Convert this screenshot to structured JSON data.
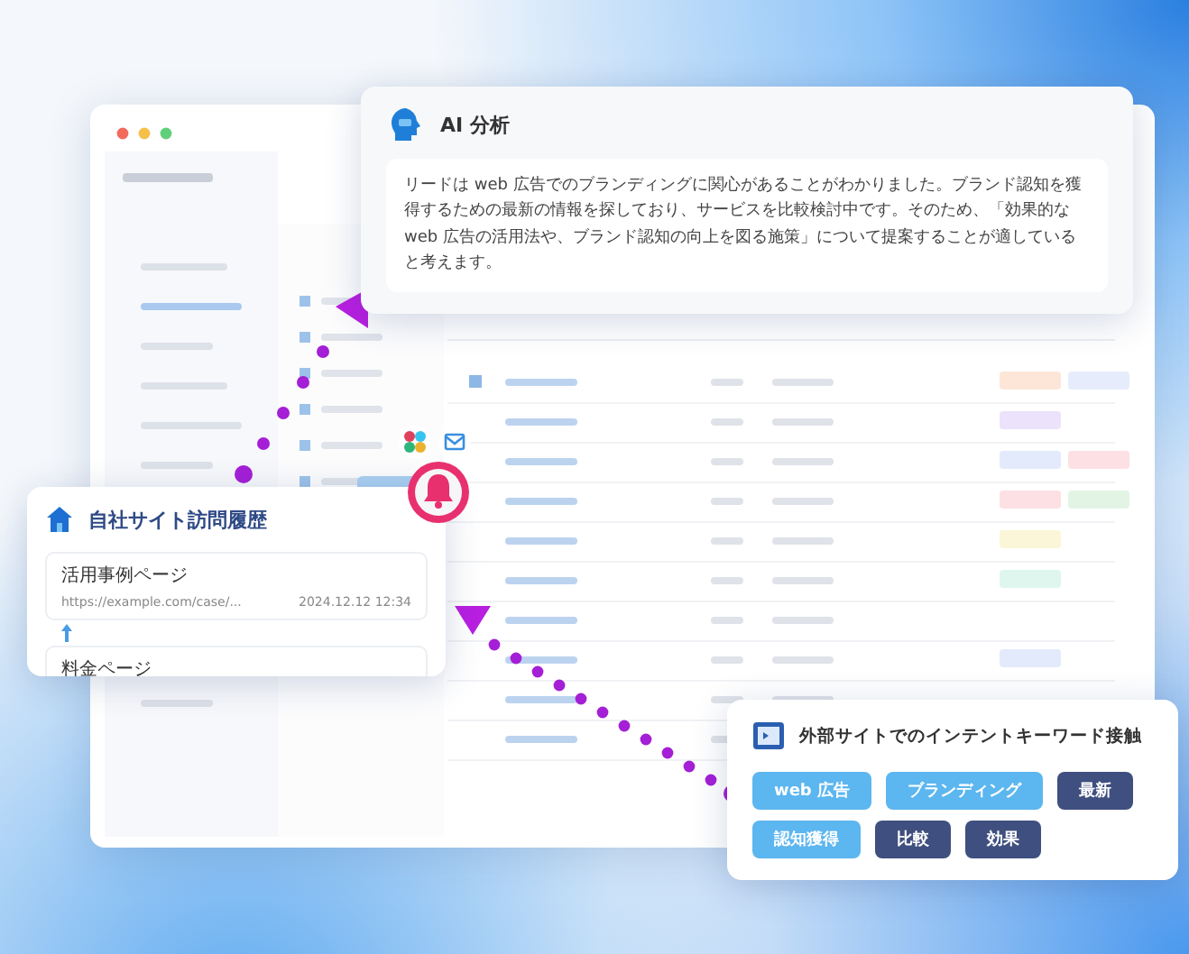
{
  "ai_card": {
    "title": "AI 分析",
    "text": "リードは web 広告でのブランディングに関心があることがわかりました。ブランド認知を獲得するための最新の情報を探しており、サービスを比較検討中です。そのため、「効果的な web 広告の活用法や、ブランド認知の向上を図る施策」について提案することが適していると考えます。"
  },
  "visit_card": {
    "title": "自社サイト訪問履歴",
    "pages": [
      {
        "title": "活用事例ページ",
        "url": "https://example.com/case/...",
        "time": "2024.12.12  12:34"
      },
      {
        "title": "料金ページ"
      }
    ]
  },
  "keyword_card": {
    "title": "外部サイトでのインテントキーワード接触",
    "keywords": [
      {
        "label": "web 広告",
        "color": "#5cb6ef"
      },
      {
        "label": "ブランディング",
        "color": "#5cb6ef"
      },
      {
        "label": "最新",
        "color": "#3f4f7f"
      },
      {
        "label": "認知獲得",
        "color": "#5cb6ef"
      },
      {
        "label": "比較",
        "color": "#3f4f7f"
      },
      {
        "label": "効果",
        "color": "#3f4f7f"
      }
    ]
  }
}
